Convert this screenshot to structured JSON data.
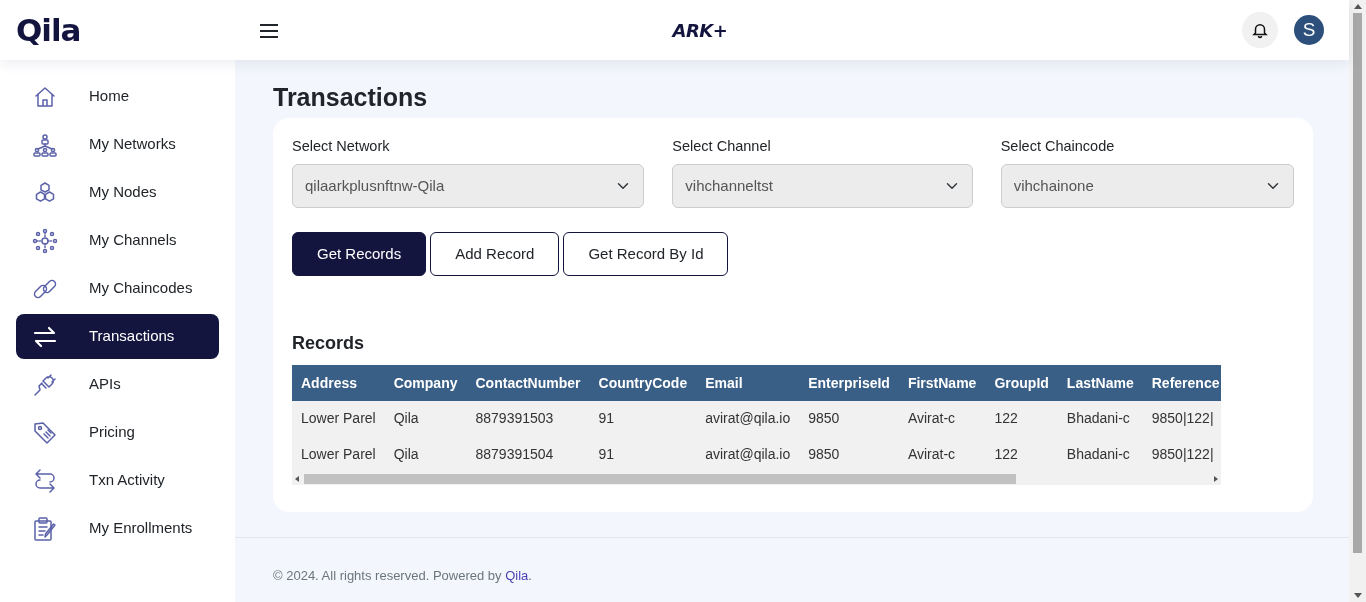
{
  "header": {
    "logo": "Qila",
    "brand": "ARK+",
    "avatar_initial": "S"
  },
  "sidebar": {
    "items": [
      {
        "label": "Home",
        "selected": false
      },
      {
        "label": "My Networks",
        "selected": false
      },
      {
        "label": "My Nodes",
        "selected": false
      },
      {
        "label": "My Channels",
        "selected": false
      },
      {
        "label": "My Chaincodes",
        "selected": false
      },
      {
        "label": "Transactions",
        "selected": true
      },
      {
        "label": "APIs",
        "selected": false
      },
      {
        "label": "Pricing",
        "selected": false
      },
      {
        "label": "Txn Activity",
        "selected": false
      },
      {
        "label": "My Enrollments",
        "selected": false
      }
    ]
  },
  "page_title": "Transactions",
  "selects": [
    {
      "label": "Select Network",
      "value": "qilaarkplusnftnw-Qila",
      "disabled": true
    },
    {
      "label": "Select Channel",
      "value": "vihchanneltst",
      "disabled": true
    },
    {
      "label": "Select Chaincode",
      "value": "vihchainone",
      "disabled": true
    }
  ],
  "buttons": [
    {
      "label": "Get Records",
      "selected": true
    },
    {
      "label": "Add Record",
      "selected": false
    },
    {
      "label": "Get Record By Id",
      "selected": false
    }
  ],
  "records": {
    "title": "Records",
    "columns": [
      "Address",
      "Company",
      "ContactNumber",
      "CountryCode",
      "Email",
      "EnterpriseId",
      "FirstName",
      "GroupId",
      "LastName",
      "Reference"
    ],
    "rows": [
      [
        "Lower Parel",
        "Qila",
        "8879391503",
        "91",
        "avirat@qila.io",
        "9850",
        "Avirat-c",
        "122",
        "Bhadani-c",
        "9850|122|"
      ],
      [
        "Lower Parel",
        "Qila",
        "8879391504",
        "91",
        "avirat@qila.io",
        "9850",
        "Avirat-c",
        "122",
        "Bhadani-c",
        "9850|122|"
      ]
    ]
  },
  "footer": {
    "text": "© 2024. All rights reserved. Powered by ",
    "link": "Qila",
    "text_end": "."
  }
}
